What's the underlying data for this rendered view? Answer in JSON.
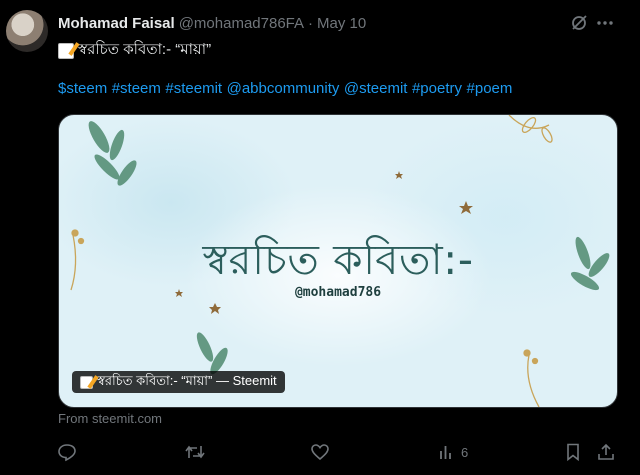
{
  "post": {
    "author_name": "Mohamad Faisal",
    "handle": "@mohamad786FA",
    "separator": "·",
    "date": "May 10",
    "title_text": "স্বরচিত কবিতা:- “মায়া”",
    "hashtags": [
      "$steem",
      "#steem",
      "#steemit",
      "@abbcommunity",
      "@steemit",
      "#poetry",
      "#poem"
    ]
  },
  "card": {
    "image_title": "স্বরচিত কবিতা:-",
    "image_handle": "@mohamad786",
    "link_label": "স্বরচিত কবিতা:- “মায়া” — Steemit",
    "source": "From steemit.com"
  },
  "actions": {
    "views_count": "6"
  },
  "icons": {
    "grok": "grok-icon",
    "more": "more-icon",
    "reply": "reply-icon",
    "repost": "repost-icon",
    "like": "like-icon",
    "views": "views-icon",
    "bookmark": "bookmark-icon",
    "share": "share-icon"
  },
  "colors": {
    "background": "#000000",
    "text": "#e7e9ea",
    "secondary": "#71767b",
    "link": "#1d9bf0",
    "card_text": "#2c5e5c"
  }
}
